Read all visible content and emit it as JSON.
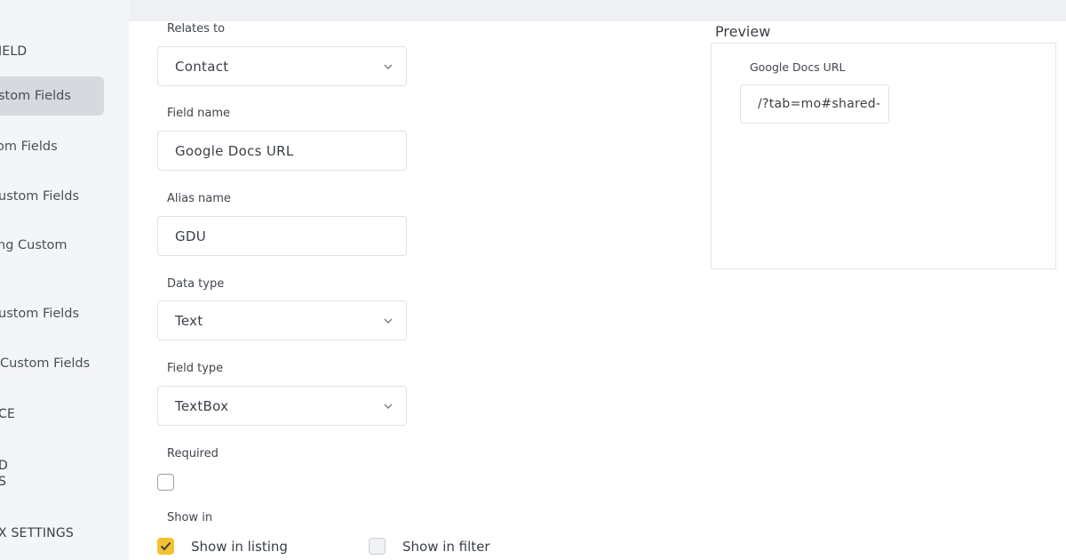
{
  "sidebar": {
    "items": [
      {
        "label": "IELD"
      },
      {
        "label": "stom Fields"
      },
      {
        "label": "om Fields"
      },
      {
        "label": "ustom Fields"
      },
      {
        "label": "ng Custom"
      },
      {
        "label": "ustom Fields"
      },
      {
        "label": "Custom Fields"
      },
      {
        "label": "CE"
      },
      {
        "label_line1": "D",
        "label_line2": "S"
      },
      {
        "label": "X SETTINGS"
      }
    ]
  },
  "form": {
    "relates_to": {
      "label": "Relates to",
      "value": "Contact"
    },
    "field_name": {
      "label": "Field name",
      "value": "Google Docs URL"
    },
    "alias_name": {
      "label": "Alias name",
      "value": "GDU"
    },
    "data_type": {
      "label": "Data type",
      "value": "Text"
    },
    "field_type": {
      "label": "Field type",
      "value": "TextBox"
    },
    "required": {
      "label": "Required",
      "checked": false
    },
    "show_in": {
      "label": "Show in",
      "listing": {
        "label": "Show in listing",
        "checked": true
      },
      "filter": {
        "label": "Show in filter",
        "checked": false
      }
    }
  },
  "preview": {
    "title": "Preview",
    "field_label": "Google Docs URL",
    "field_value": "/?tab=mo#shared-"
  },
  "colors": {
    "accent": "#f5c12e",
    "sidebar_active": "#d6d9de"
  },
  "icons": {
    "select": "chevron-down-icon",
    "check": "check-icon"
  }
}
